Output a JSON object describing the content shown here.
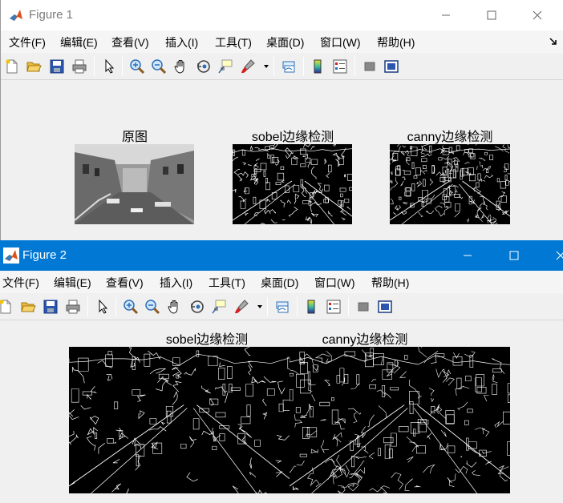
{
  "figure1": {
    "title": "Figure 1",
    "menu": [
      "文件(F)",
      "编辑(E)",
      "查看(V)",
      "插入(I)",
      "工具(T)",
      "桌面(D)",
      "窗口(W)",
      "帮助(H)"
    ],
    "axes": [
      {
        "title": "原图"
      },
      {
        "title": "sobel边缘检测"
      },
      {
        "title": "canny边缘检测"
      }
    ]
  },
  "figure2": {
    "title": "Figure 2",
    "menu": [
      "文件(F)",
      "编辑(E)",
      "查看(V)",
      "插入(I)",
      "工具(T)",
      "桌面(D)",
      "窗口(W)",
      "帮助(H)"
    ],
    "axes": [
      {
        "title": "sobel边缘检测"
      },
      {
        "title": "canny边缘检测"
      }
    ]
  },
  "icons": [
    "new-figure-icon",
    "open-file-icon",
    "save-icon",
    "print-icon",
    "pointer-icon",
    "zoom-in-icon",
    "zoom-out-icon",
    "pan-hand-icon",
    "rotate-3d-icon",
    "data-cursor-icon",
    "brush-icon",
    "link-plot-icon",
    "colorbar-icon",
    "legend-icon",
    "hide-plot-tools-icon",
    "show-plot-tools-icon"
  ],
  "colors": {
    "accent": "#0078d4",
    "inactive_title": "#7a7a7a"
  }
}
